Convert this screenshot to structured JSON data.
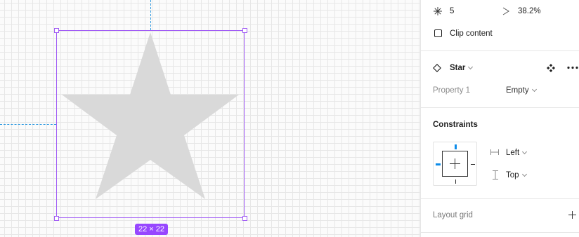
{
  "canvas": {
    "size_badge": "22 × 22",
    "selection_color": "#a15cf5",
    "star_fill": "#d9d9d9",
    "guide_color": "#2f9ae0"
  },
  "panel": {
    "points_value": "5",
    "ratio_value": "38.2%",
    "clip_content_label": "Clip content",
    "component_name": "Star",
    "property_label": "Property 1",
    "property_value": "Empty",
    "constraints_title": "Constraints",
    "horizontal_constraint": "Left",
    "vertical_constraint": "Top",
    "layout_grid_label": "Layout grid",
    "accent_color": "#0d8ce9"
  }
}
